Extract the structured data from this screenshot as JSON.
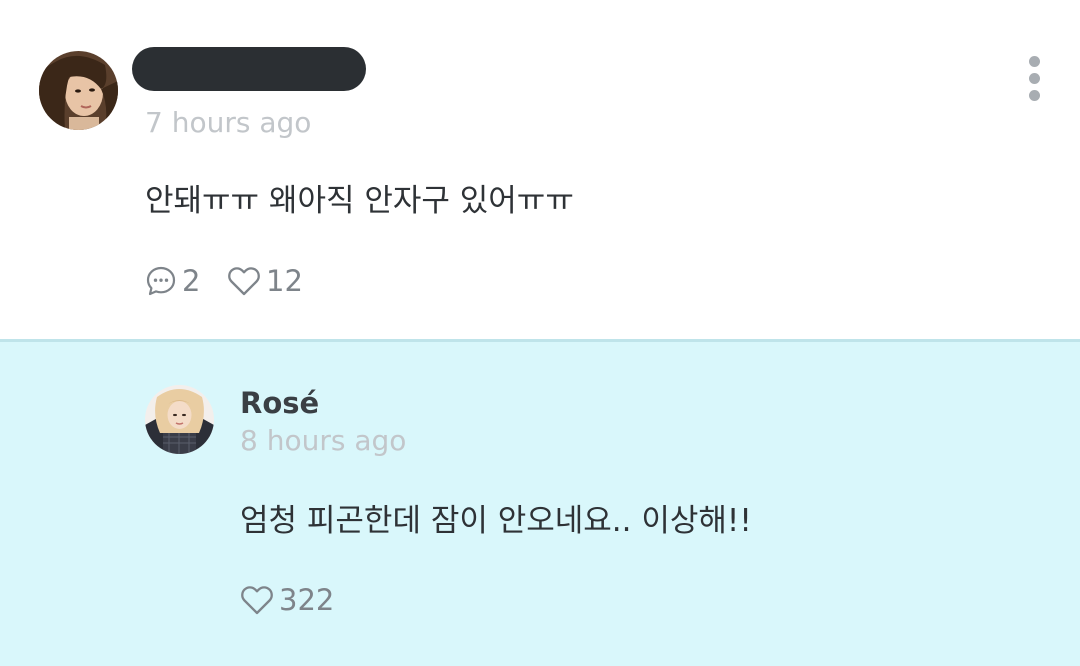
{
  "comment": {
    "timestamp": "7 hours ago",
    "text": "안돼ㅠㅠ 왜아직 안자구 있어ㅠㅠ",
    "reply_count": "2",
    "like_count": "12",
    "avatar_icon": "user-avatar-photo",
    "menu_icon": "more-vertical-icon"
  },
  "reply": {
    "author": "Rosé",
    "timestamp": "8 hours ago",
    "text": "엄청 피곤한데 잠이 안오네요.. 이상해!!",
    "like_count": "322",
    "avatar_icon": "user-avatar-photo"
  },
  "colors": {
    "reply_background": "#d9f7fb",
    "timestamp": "#c2c6ca",
    "body_text": "#2e3236",
    "action_text": "#7e848a"
  }
}
